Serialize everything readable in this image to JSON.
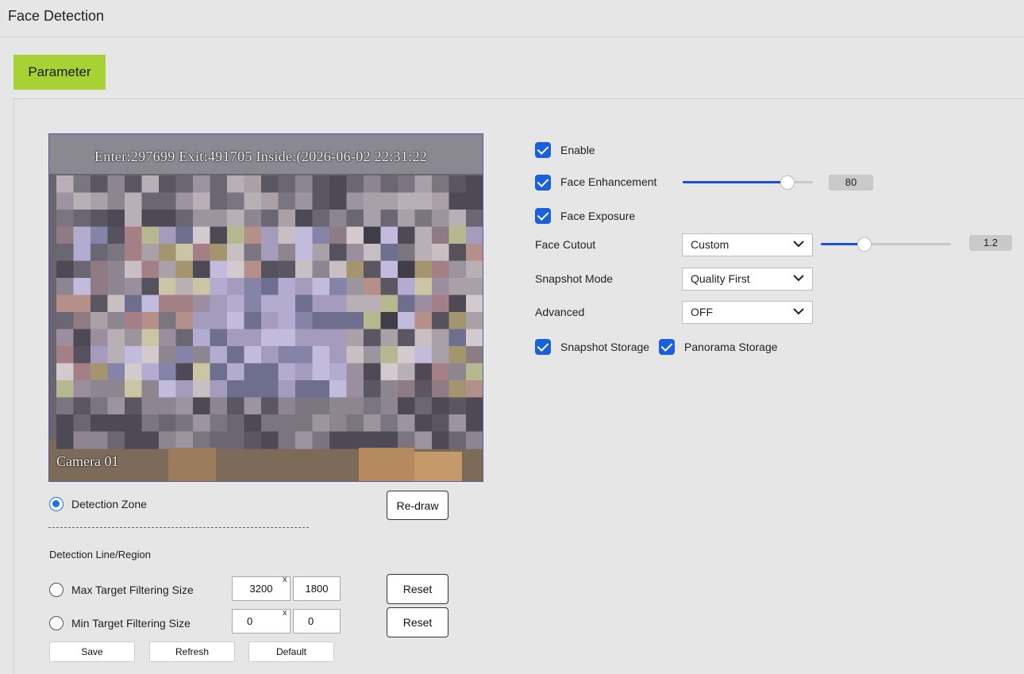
{
  "page": {
    "title": "Face Detection"
  },
  "tabs": [
    {
      "label": "Parameter",
      "active": true,
      "color": "#a6d234"
    }
  ],
  "video": {
    "osd_top": "Enter:297699  Exit:491705  Inside:(2026-06-02  22:31:22",
    "osd_camera": "Camera  01"
  },
  "detection_zone": {
    "label": "Detection Zone",
    "selected": true,
    "redraw_label": "Re-draw"
  },
  "detection_line": {
    "heading": "Detection Line/Region"
  },
  "max_filter": {
    "label": "Max Target Filtering Size",
    "width": "3200",
    "height": "1800",
    "separator": "x",
    "reset_label": "Reset",
    "selected": false
  },
  "min_filter": {
    "label": "Min Target Filtering Size",
    "width": "0",
    "height": "0",
    "separator": "x",
    "reset_label": "Reset",
    "selected": false
  },
  "footer_buttons": {
    "save": "Save",
    "refresh": "Refresh",
    "default": "Default"
  },
  "settings": {
    "enable": {
      "label": "Enable",
      "checked": true
    },
    "face_enhancement": {
      "label": "Face Enhancement",
      "checked": true,
      "value": "80",
      "level": 0.8
    },
    "face_exposure": {
      "label": "Face Exposure",
      "checked": true
    },
    "face_cutout": {
      "label": "Face Cutout",
      "selected": "Custom",
      "value": "1.2",
      "level": 0.33
    },
    "snapshot_mode": {
      "label": "Snapshot Mode",
      "selected": "Quality First"
    },
    "advanced": {
      "label": "Advanced",
      "selected": "OFF"
    },
    "snapshot_storage": {
      "label": "Snapshot Storage",
      "checked": true
    },
    "panorama_storage": {
      "label": "Panorama Storage",
      "checked": true
    }
  },
  "colors": {
    "accent": "#1a5fdc",
    "tab": "#a6d234",
    "background": "#e6e6e6"
  }
}
